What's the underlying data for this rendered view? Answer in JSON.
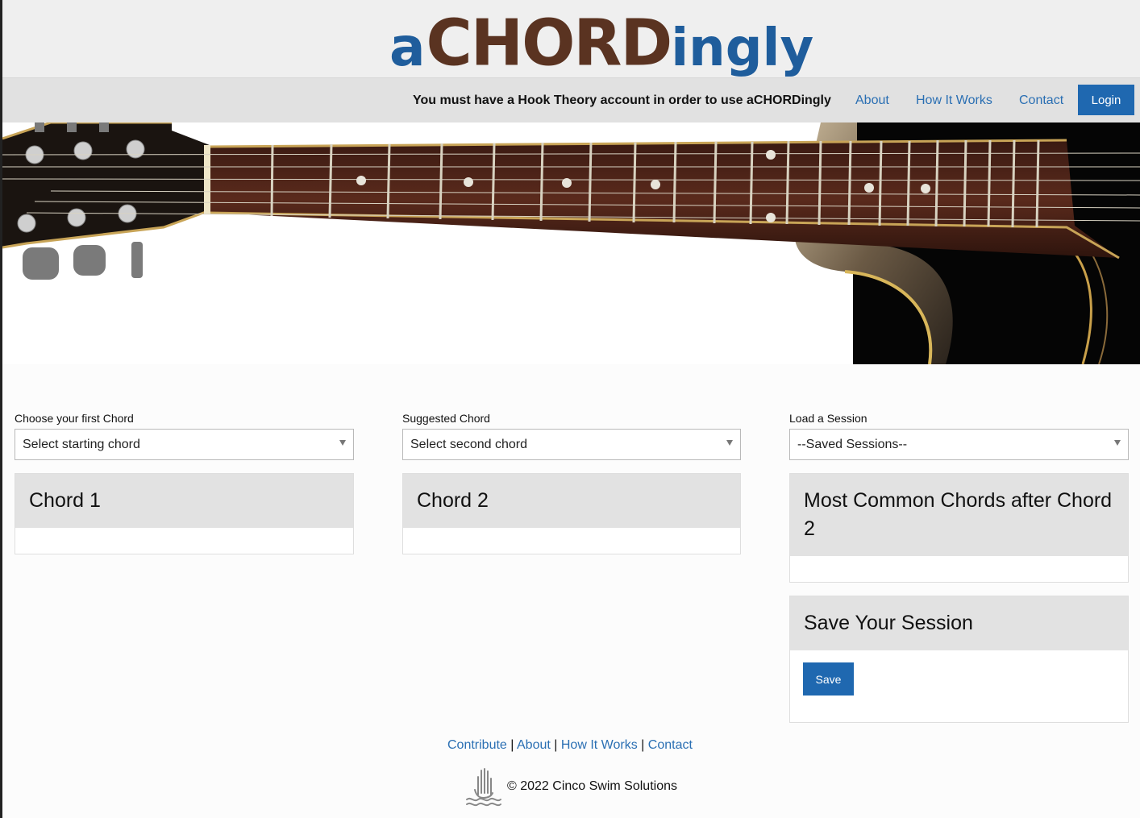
{
  "logo": {
    "part_a": "a",
    "part_chord": "CHORD",
    "part_ingly": "ingly"
  },
  "nav": {
    "notice": "You must have a Hook Theory account in order to use aCHORDingly",
    "about": "About",
    "how_it_works": "How It Works",
    "contact": "Contact",
    "login": "Login"
  },
  "hero": {
    "icon": "guitar-fretboard-image"
  },
  "controls": {
    "first_chord_label": "Choose your first Chord",
    "first_chord_value": "Select starting chord",
    "suggested_label": "Suggested Chord",
    "suggested_value": "Select second chord",
    "session_label": "Load a Session",
    "session_value": "--Saved Sessions--"
  },
  "panels": {
    "chord1_title": "Chord 1",
    "chord2_title": "Chord 2",
    "common_title": "Most Common Chords after Chord 2",
    "save_title": "Save Your Session",
    "save_button": "Save"
  },
  "footer": {
    "contribute": "Contribute",
    "about": "About",
    "how_it_works": "How It Works",
    "contact": "Contact",
    "separator": "|",
    "copyright": "© 2022 Cinco Swim Solutions",
    "logo_icon": "raised-hand-water-icon"
  },
  "colors": {
    "brand_blue": "#1f68b0",
    "brand_brown": "#5a3321",
    "link": "#2a6fb3"
  }
}
